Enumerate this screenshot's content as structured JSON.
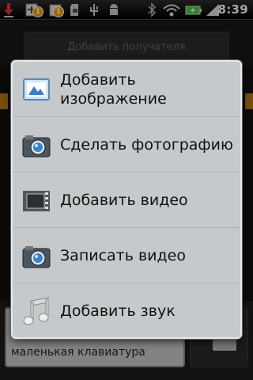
{
  "status_bar": {
    "time": "8:39",
    "badge_1": "1",
    "badge_2": "1",
    "icons": [
      "download-arrow-icon",
      "add-notification-icon",
      "notification-badge-icon",
      "sd-card-icon",
      "usb-icon",
      "android-debug-icon",
      "bluetooth-icon",
      "wifi-icon",
      "battery-charging-icon",
      "signal-icon"
    ]
  },
  "compose": {
    "recipient_placeholder": "Добавить получателя",
    "message_line_hidden": "...",
    "message_text": "маленькая клавиатура"
  },
  "menu": {
    "items": [
      {
        "label": "Добавить изображение",
        "icon": "picture-icon"
      },
      {
        "label": "Сделать фотографию",
        "icon": "camera-icon"
      },
      {
        "label": "Добавить видео",
        "icon": "video-film-icon"
      },
      {
        "label": "Записать видео",
        "icon": "video-camera-icon"
      },
      {
        "label": "Добавить звук",
        "icon": "music-note-icon"
      }
    ]
  }
}
